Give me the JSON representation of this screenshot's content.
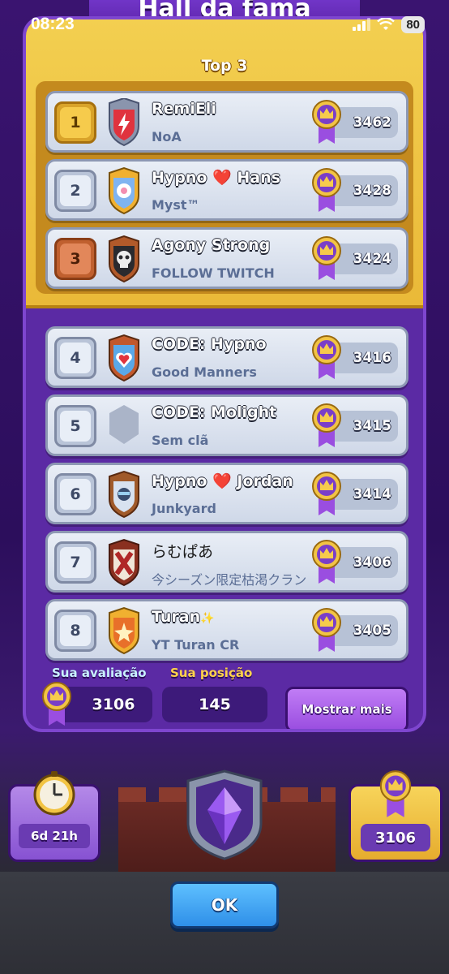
{
  "status_bar": {
    "time": "08:23",
    "battery": "80",
    "icons": [
      "signal-icon",
      "wifi-icon",
      "battery-icon"
    ]
  },
  "header": {
    "title": "Hall da fama"
  },
  "top3": {
    "label": "Top 3"
  },
  "leaderboard": [
    {
      "rank": "1",
      "name": "RemiEli",
      "clan": "NoA",
      "trophies": "3462",
      "badge": "shield-lightning-badge",
      "rank_style": "gold"
    },
    {
      "rank": "2",
      "name_pre": "Hypno ",
      "name_heart": "❤️",
      "name_post": " Hans",
      "clan": "Myst™",
      "trophies": "3428",
      "badge": "shield-flower-badge",
      "rank_style": "silver"
    },
    {
      "rank": "3",
      "name": "Agony Strong",
      "clan": "FOLLOW TWITCH",
      "trophies": "3424",
      "badge": "shield-skull-badge",
      "rank_style": "bronze"
    },
    {
      "rank": "4",
      "name": "CODE: Hypno",
      "clan": "Good Manners",
      "trophies": "3416",
      "badge": "shield-heart-badge",
      "rank_style": "silver"
    },
    {
      "rank": "5",
      "name": "CODE: Molight",
      "clan": "Sem clã",
      "trophies": "3415",
      "badge": "shield-empty-badge",
      "rank_style": "silver"
    },
    {
      "rank": "6",
      "name_pre": "Hypno ",
      "name_heart": "❤️",
      "name_post": " Jordan",
      "clan": "Junkyard",
      "trophies": "3414",
      "badge": "shield-face-badge",
      "rank_style": "silver"
    },
    {
      "rank": "7",
      "name": "らむぱあ",
      "clan": "今シーズン限定枯渇クラン",
      "trophies": "3406",
      "badge": "shield-cross-badge",
      "rank_style": "silver"
    },
    {
      "rank": "8",
      "name": "Turan",
      "name_spark": "✨",
      "clan": "YT Turan CR",
      "trophies": "3405",
      "badge": "shield-star-badge",
      "rank_style": "silver"
    }
  ],
  "footer": {
    "rating_label": "Sua avaliação",
    "rating_value": "3106",
    "position_label": "Sua posição",
    "position_value": "145",
    "show_more": "Mostrar mais"
  },
  "season": {
    "timer": "6d 21h",
    "trophies": "3106"
  },
  "ok_label": "OK"
}
